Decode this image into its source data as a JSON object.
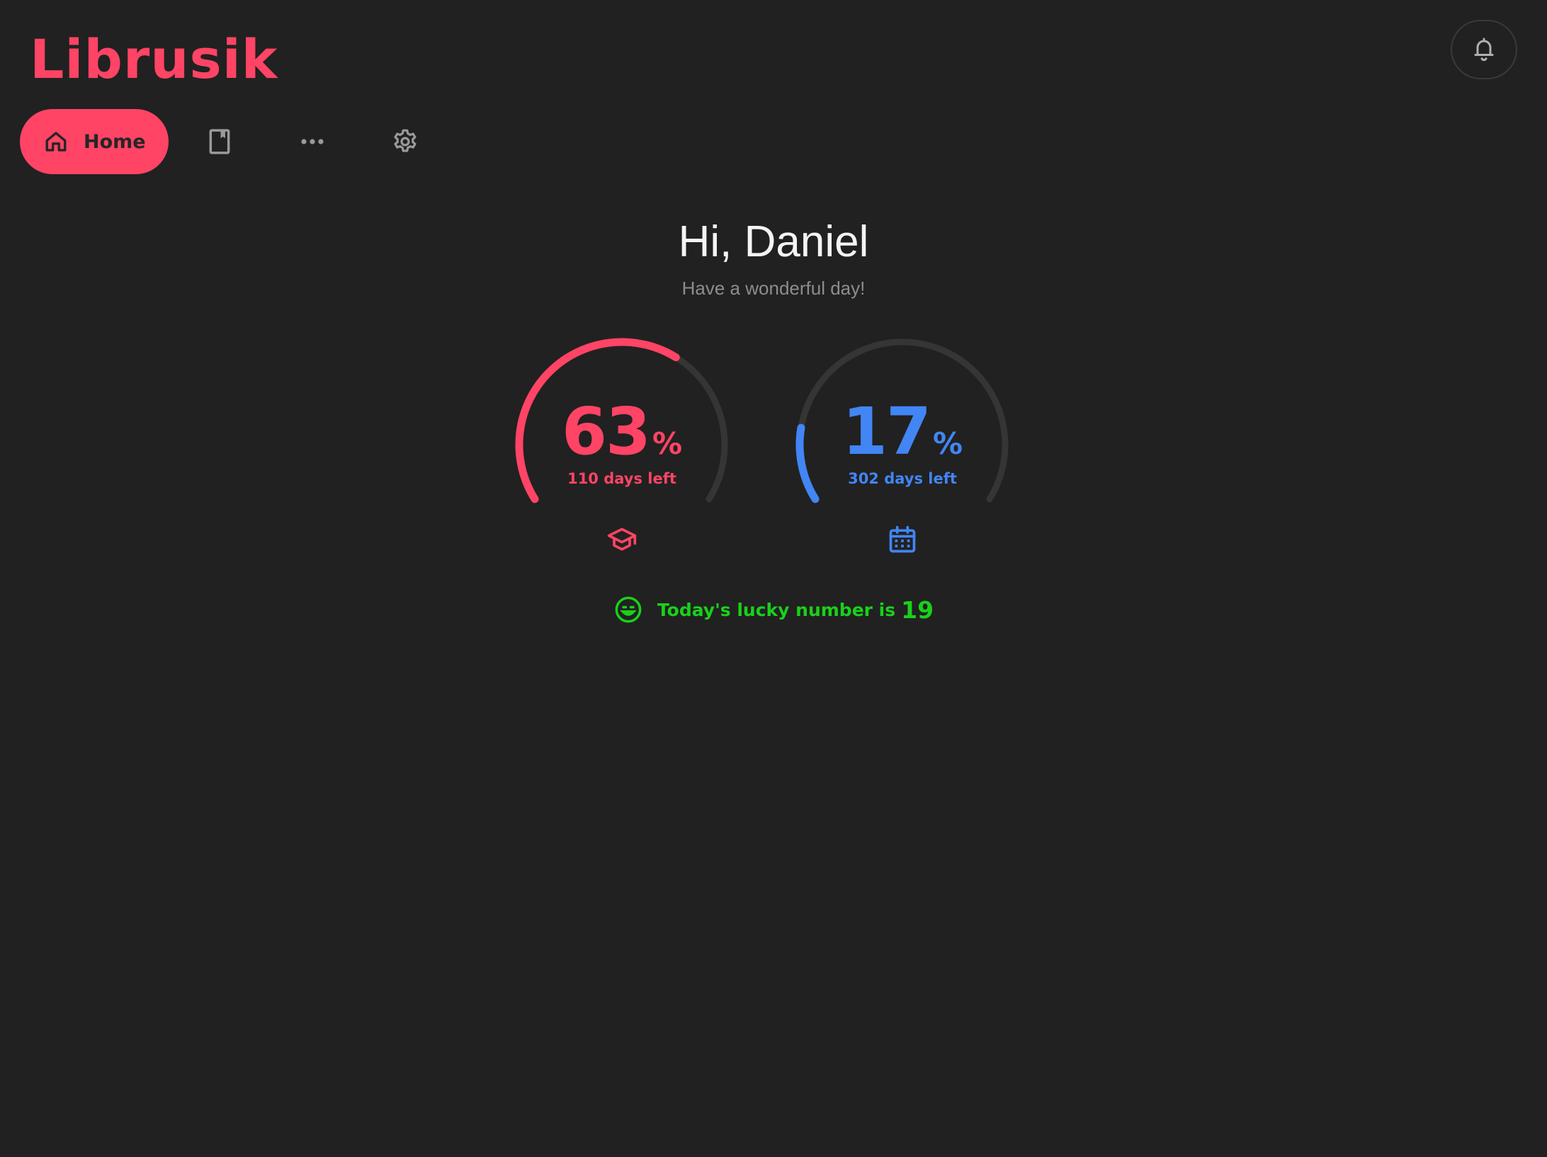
{
  "app": {
    "title": "Librusik"
  },
  "theme": {
    "background": "#212121",
    "accent": "#ff4465",
    "secondary": "#4285f4",
    "success": "#19d119",
    "track": "#353535"
  },
  "header": {
    "notifications_icon": "bell-icon"
  },
  "nav": {
    "items": [
      {
        "label": "Home",
        "icon": "home-icon",
        "active": true
      },
      {
        "label": "",
        "icon": "book-icon",
        "active": false
      },
      {
        "label": "",
        "icon": "more-dots-icon",
        "active": false
      },
      {
        "label": "",
        "icon": "gear-icon",
        "active": false
      }
    ]
  },
  "greeting": {
    "title": "Hi, Daniel",
    "subtitle": "Have a wonderful day!"
  },
  "progress_rings": [
    {
      "value": "63",
      "unit": "%",
      "fraction": 0.63,
      "caption": "110 days left",
      "icon": "graduation-cap-icon",
      "color": "#ff4465"
    },
    {
      "value": "17",
      "unit": "%",
      "fraction": 0.17,
      "caption": "302 days left",
      "icon": "calendar-icon",
      "color": "#4285f4"
    }
  ],
  "lucky": {
    "text": "Today's lucky number is",
    "number": "19",
    "icon": "smile-icon"
  }
}
